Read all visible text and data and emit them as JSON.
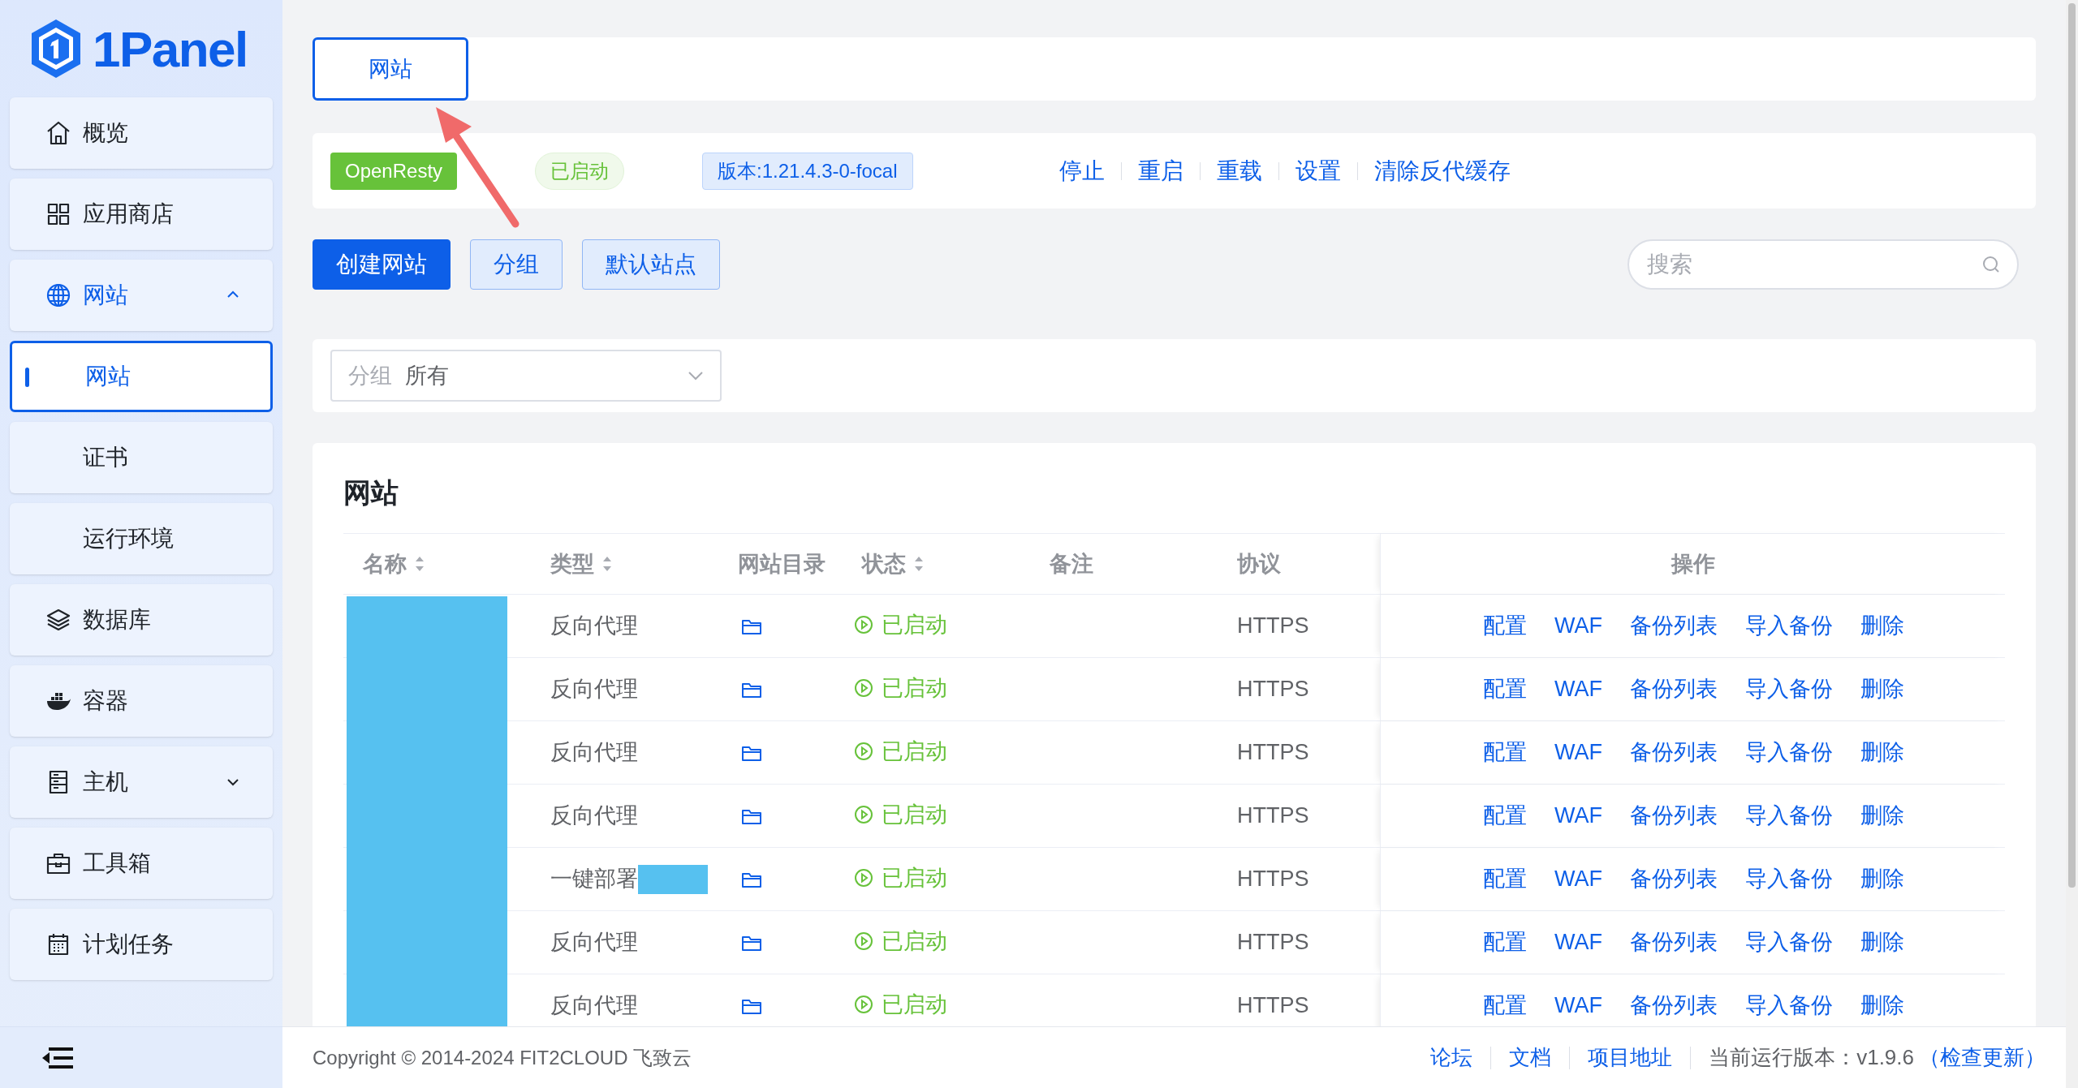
{
  "sidebar": {
    "logo": "1Panel",
    "items": [
      {
        "label": "概览",
        "kind": "link",
        "selected": false
      },
      {
        "label": "应用商店",
        "kind": "link",
        "selected": false
      },
      {
        "label": "网站",
        "kind": "group",
        "selected": true,
        "expanded": true,
        "children": [
          {
            "label": "网站",
            "selected": true
          },
          {
            "label": "证书",
            "selected": false
          },
          {
            "label": "运行环境",
            "selected": false
          }
        ]
      },
      {
        "label": "数据库",
        "kind": "link",
        "selected": false
      },
      {
        "label": "容器",
        "kind": "link",
        "selected": false
      },
      {
        "label": "主机",
        "kind": "group",
        "selected": false,
        "expanded": false
      },
      {
        "label": "工具箱",
        "kind": "link",
        "selected": false
      },
      {
        "label": "计划任务",
        "kind": "link",
        "selected": false
      }
    ]
  },
  "tabs": [
    {
      "label": "网站",
      "selected": true
    }
  ],
  "service": {
    "name": "OpenResty",
    "status": "已启动",
    "version": "版本:1.21.4.3-0-focal",
    "actions": [
      "停止",
      "重启",
      "重载",
      "设置",
      "清除反代缓存"
    ]
  },
  "toolbar": {
    "buttons": [
      {
        "label": "创建网站",
        "kind": "primary"
      },
      {
        "label": "分组",
        "kind": "plain"
      },
      {
        "label": "默认站点",
        "kind": "plain"
      }
    ],
    "search": {
      "placeholder": "搜索"
    }
  },
  "filter": {
    "label": "分组",
    "value": "所有"
  },
  "table": {
    "title": "网站",
    "columns": [
      {
        "label": "名称",
        "sortable": true
      },
      {
        "label": "类型",
        "sortable": true
      },
      {
        "label": "网站目录",
        "sortable": false
      },
      {
        "label": "状态",
        "sortable": true
      },
      {
        "label": "备注",
        "sortable": false
      },
      {
        "label": "协议",
        "sortable": false
      },
      {
        "label": "操作",
        "sortable": false
      }
    ],
    "rows": [
      {
        "type": "反向代理",
        "redacted": false,
        "status": "已启动",
        "protocol": "HTTPS",
        "actions": [
          "配置",
          "WAF",
          "备份列表",
          "导入备份",
          "删除"
        ]
      },
      {
        "type": "反向代理",
        "redacted": false,
        "status": "已启动",
        "protocol": "HTTPS",
        "actions": [
          "配置",
          "WAF",
          "备份列表",
          "导入备份",
          "删除"
        ]
      },
      {
        "type": "反向代理",
        "redacted": false,
        "status": "已启动",
        "protocol": "HTTPS",
        "actions": [
          "配置",
          "WAF",
          "备份列表",
          "导入备份",
          "删除"
        ]
      },
      {
        "type": "反向代理",
        "redacted": false,
        "status": "已启动",
        "protocol": "HTTPS",
        "actions": [
          "配置",
          "WAF",
          "备份列表",
          "导入备份",
          "删除"
        ]
      },
      {
        "type": "一键部署",
        "redacted": true,
        "status": "已启动",
        "protocol": "HTTPS",
        "actions": [
          "配置",
          "WAF",
          "备份列表",
          "导入备份",
          "删除"
        ]
      },
      {
        "type": "反向代理",
        "redacted": false,
        "status": "已启动",
        "protocol": "HTTPS",
        "actions": [
          "配置",
          "WAF",
          "备份列表",
          "导入备份",
          "删除"
        ]
      },
      {
        "type": "反向代理",
        "redacted": false,
        "status": "已启动",
        "protocol": "HTTPS",
        "actions": [
          "配置",
          "WAF",
          "备份列表",
          "导入备份",
          "删除"
        ]
      }
    ]
  },
  "footer": {
    "copyright": "Copyright © 2014-2024 FIT2CLOUD 飞致云",
    "links": [
      "论坛",
      "文档",
      "项目地址"
    ],
    "version": "当前运行版本：v1.9.6",
    "update_link": "（检查更新）"
  }
}
